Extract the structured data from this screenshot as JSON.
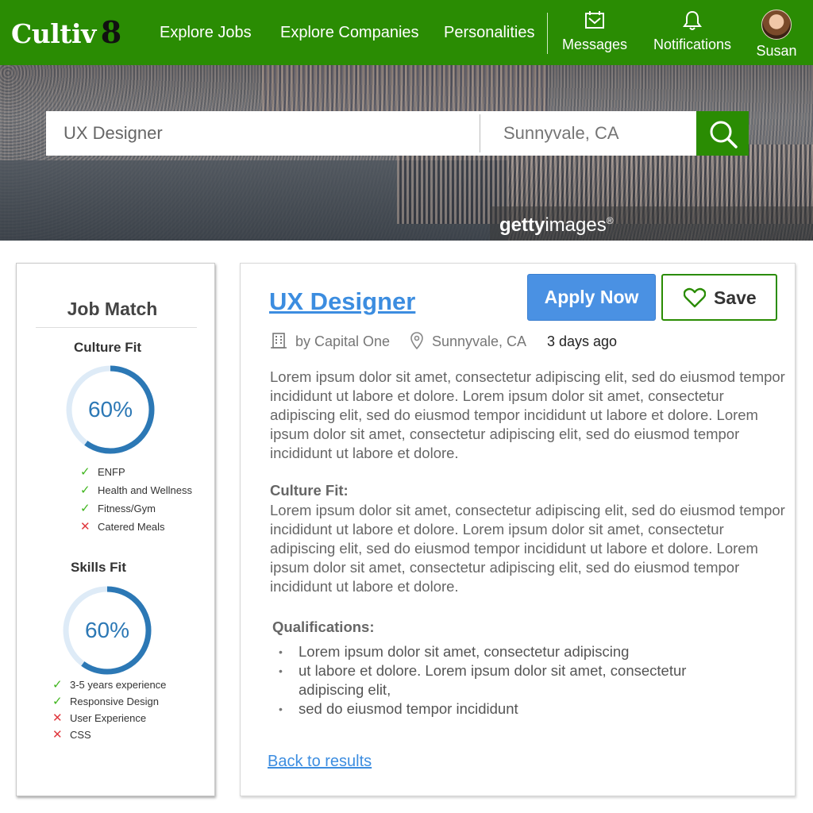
{
  "nav": {
    "logo_text": "Cultiv",
    "logo_number": "8",
    "links": [
      "Explore Jobs",
      "Explore Companies",
      "Personalities"
    ],
    "messages_label": "Messages",
    "notifications_label": "Notifications",
    "user_name": "Susan"
  },
  "hero": {
    "watermark_bold": "getty",
    "watermark_rest": "images",
    "watermark_mark": "®"
  },
  "search": {
    "job_value": "UX Designer",
    "location_placeholder": "Sunnyvale, CA"
  },
  "sidebar": {
    "title": "Job Match",
    "culture": {
      "heading": "Culture Fit",
      "percent_label": "60%",
      "percent": 0.6,
      "items": [
        {
          "label": "ENFP",
          "match": true
        },
        {
          "label": "Health and Wellness",
          "match": true
        },
        {
          "label": "Fitness/Gym",
          "match": true
        },
        {
          "label": "Catered Meals",
          "match": false
        }
      ]
    },
    "skills": {
      "heading": "Skills Fit",
      "percent_label": "60%",
      "percent": 0.6,
      "items": [
        {
          "label": "3-5 years experience",
          "match": true
        },
        {
          "label": "Responsive Design",
          "match": true
        },
        {
          "label": "User Experience",
          "match": false
        },
        {
          "label": "CSS",
          "match": false
        }
      ]
    }
  },
  "job": {
    "title": "UX Designer",
    "apply_label": "Apply Now",
    "save_label": "Save",
    "company": "by Capital One",
    "location": "Sunnyvale, CA",
    "posted": "3 days ago",
    "description": "Lorem ipsum dolor sit amet, consectetur adipiscing elit, sed do eiusmod tempor incididunt ut labore et dolore. Lorem ipsum dolor sit amet, consectetur adipiscing elit, sed do eiusmod tempor incididunt ut labore et dolore. Lorem ipsum dolor sit amet, consectetur adipiscing elit, sed do eiusmod tempor incididunt ut labore et dolore.",
    "culture_heading": "Culture Fit:",
    "culture_text": "Lorem ipsum dolor sit amet, consectetur adipiscing elit, sed do eiusmod tempor incididunt ut labore et dolore. Lorem ipsum dolor sit amet, consectetur adipiscing elit, sed do eiusmod tempor incididunt ut labore et dolore. Lorem ipsum dolor sit amet, consectetur adipiscing elit, sed do eiusmod tempor incididunt ut labore et dolore.",
    "qualifications_heading": "Qualifications:",
    "qualifications": [
      "Lorem ipsum dolor sit amet, consectetur adipiscing",
      "ut labore et dolore. Lorem ipsum dolor sit amet, consectetur adipiscing elit,",
      "sed do eiusmod tempor incididunt"
    ],
    "back_label": "Back to results"
  },
  "colors": {
    "brand_green": "#2a8c03",
    "link_blue": "#3c8de0",
    "apply_blue": "#4a91e3",
    "ring_blue": "#2c78b5",
    "check_green": "#3fb51d",
    "cross_red": "#e0383e"
  },
  "icons": [
    "search-icon",
    "calendar-mail-icon",
    "bell-icon",
    "heart-icon",
    "building-icon",
    "location-pin-icon",
    "check-icon",
    "cross-icon"
  ]
}
